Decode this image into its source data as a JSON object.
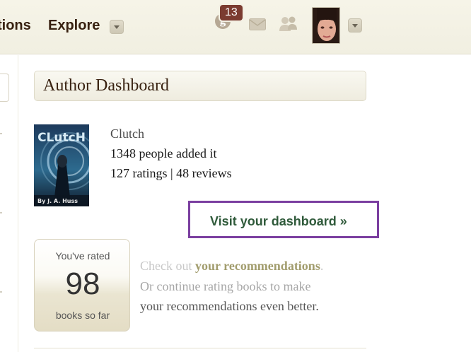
{
  "header": {
    "nav_partial": "tions",
    "nav_explore": "Explore",
    "notifications_count": "13",
    "notifications_icon_letter": "g"
  },
  "dashboard": {
    "title": "Author Dashboard",
    "book": {
      "title": "Clutch",
      "added": "1348 people added it",
      "ratings_reviews": "127 ratings | 48 reviews",
      "cover_title": "CLutcH",
      "cover_author": "By J. A. Huss"
    },
    "visit_button": "Visit your dashboard »"
  },
  "rated": {
    "top_text": "You've rated",
    "count": "98",
    "bottom_text": "books so far"
  },
  "recommendations": {
    "line1_prefix": "Check out ",
    "line1_link": "your recommendations",
    "line1_suffix": ".",
    "line2_prefix": "Or continue ",
    "line2_link": "rating books",
    "line2_suffix": " to make",
    "line3": "your recommendations even better."
  },
  "colors": {
    "header_bg": "#f3f1e4",
    "title_brown": "#382110",
    "badge": "#7b3b30",
    "button_border": "#7b3fa0",
    "button_text": "#2f5a3a",
    "link": "#a29d6e"
  }
}
